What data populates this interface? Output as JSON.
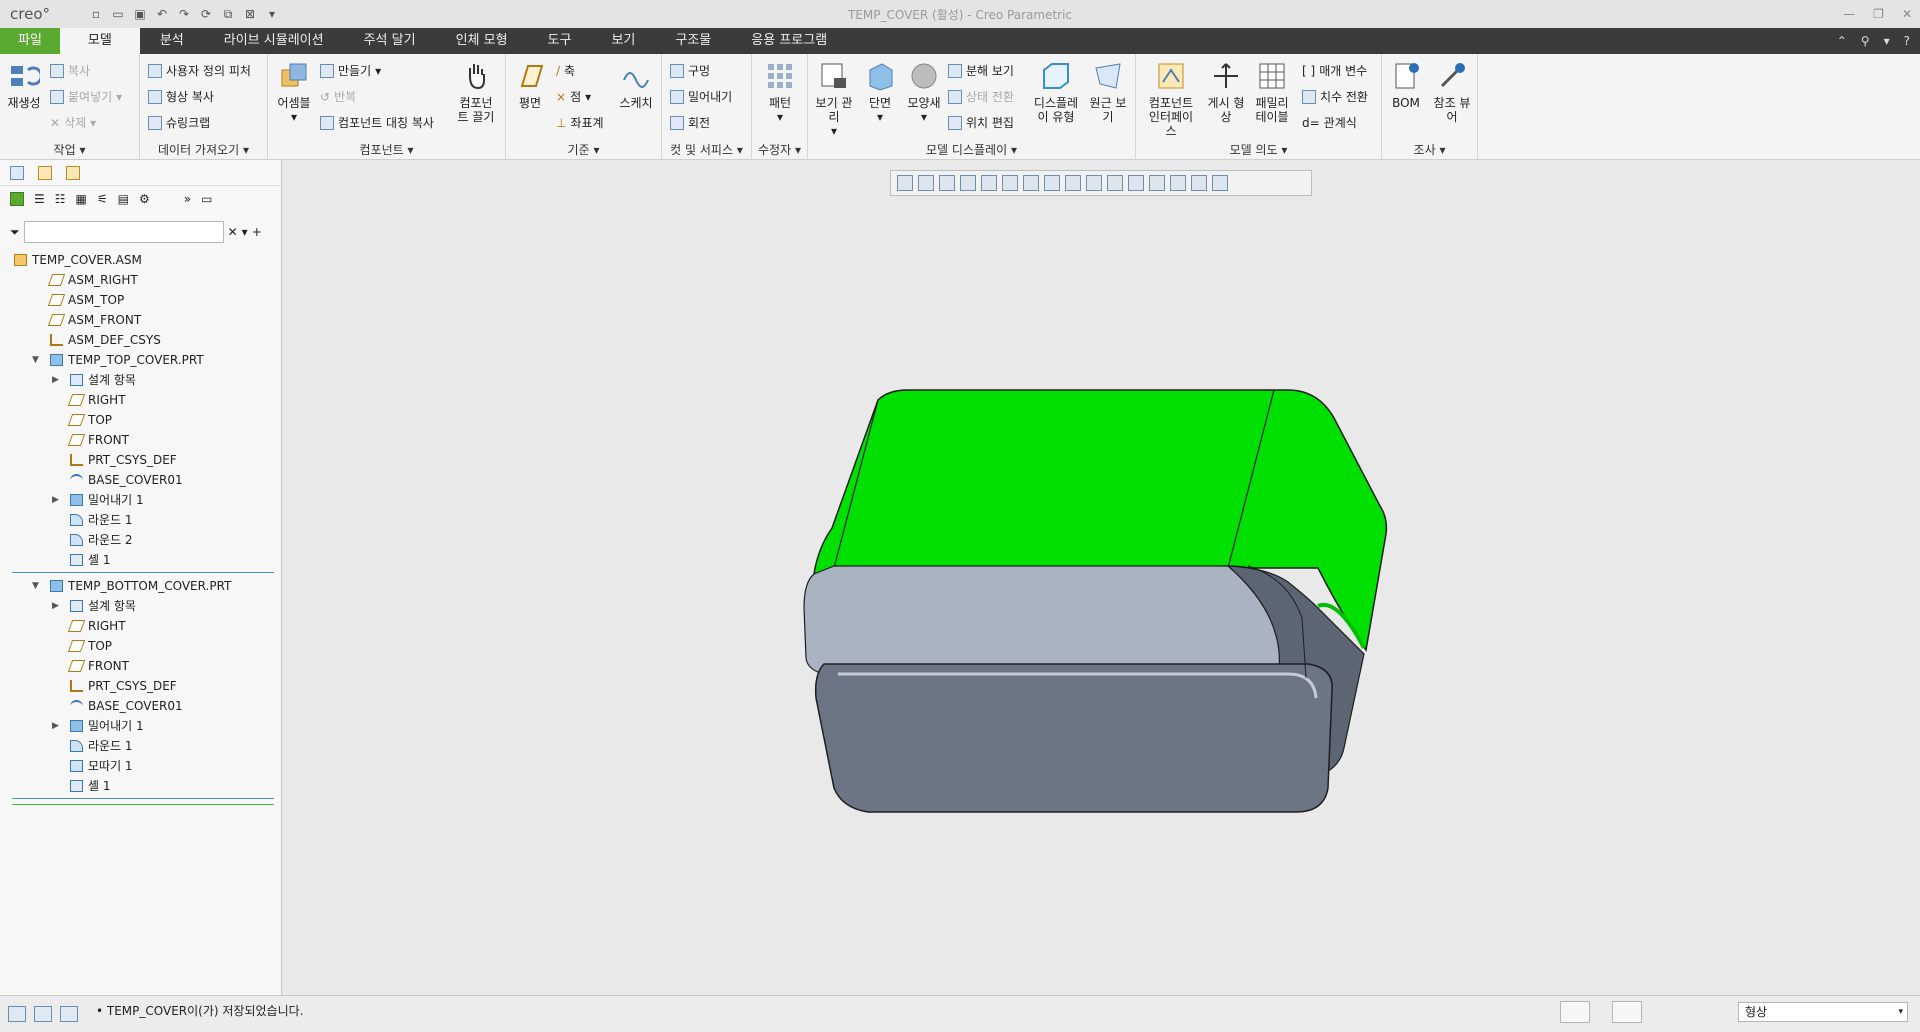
{
  "app": {
    "logo": "creo°",
    "title": "TEMP_COVER (활성) - Creo Parametric"
  },
  "menu": {
    "tabs": [
      "파일",
      "모델",
      "분석",
      "라이브 시뮬레이션",
      "주석 달기",
      "인체 모형",
      "도구",
      "보기",
      "구조물",
      "응용 프로그램"
    ],
    "active": "모델"
  },
  "ribbon": {
    "operations": {
      "regen": "재생성",
      "copy": "복사",
      "paste": "붙여넣기",
      "delete": "삭제",
      "label": "작업"
    },
    "get_data": {
      "udf": "사용자 정의 피처",
      "copy_geom": "형상 복사",
      "shrinkwrap": "슈링크랩",
      "label": "데이터 가져오기"
    },
    "component": {
      "assemble": "어셈블",
      "create": "만들기",
      "repeat": "반복",
      "mirror": "컴포넌트 대칭 복사",
      "drag": "컴포넌트 끌기",
      "label": "컴포넌트"
    },
    "datum": {
      "plane": "평면",
      "axis": "축",
      "point": "점",
      "csys": "좌표계",
      "sketch": "스케치",
      "label": "기준"
    },
    "cut_surface": {
      "hole": "구멍",
      "extrude": "밀어내기",
      "revolve": "회전",
      "label": "컷 및 서피스"
    },
    "modifiers": {
      "pattern": "패턴",
      "label": "수정자"
    },
    "model_display": {
      "view_manager": "보기 관리",
      "section": "단면",
      "appearance": "모양새",
      "exploded": "분해 보기",
      "toggle_status": "상태 전환",
      "edit_position": "위치 편집",
      "display_style": "디스플레이 유형",
      "perspective": "원근 보기",
      "label": "모델 디스플레이"
    },
    "model_intent": {
      "comp_interface": "컴포넌트 인터페이스",
      "publish_geom": "게시 형상",
      "family_table": "패밀리 테이블",
      "parameters": "매개 변수",
      "switch_dims": "치수 전환",
      "relations": "관계식",
      "label": "모델 의도"
    },
    "investigate": {
      "bom": "BOM",
      "ref_viewer": "참조 뷰어",
      "label": "조사"
    }
  },
  "tree": {
    "search_placeholder": "",
    "items": [
      {
        "label": "TEMP_COVER.ASM",
        "level": 0,
        "icon": "assembly-icon"
      },
      {
        "label": "ASM_RIGHT",
        "level": 1,
        "icon": "datum-plane-icon"
      },
      {
        "label": "ASM_TOP",
        "level": 1,
        "icon": "datum-plane-icon"
      },
      {
        "label": "ASM_FRONT",
        "level": 1,
        "icon": "datum-plane-icon"
      },
      {
        "label": "ASM_DEF_CSYS",
        "level": 1,
        "icon": "csys-icon"
      },
      {
        "label": "TEMP_TOP_COVER.PRT",
        "level": 1,
        "icon": "part-icon",
        "expanded": true
      },
      {
        "label": "설계 항목",
        "level": 2,
        "icon": "design-items-icon",
        "collapsed": true
      },
      {
        "label": "RIGHT",
        "level": 2,
        "icon": "datum-plane-icon"
      },
      {
        "label": "TOP",
        "level": 2,
        "icon": "datum-plane-icon"
      },
      {
        "label": "FRONT",
        "level": 2,
        "icon": "datum-plane-icon"
      },
      {
        "label": "PRT_CSYS_DEF",
        "level": 2,
        "icon": "csys-icon"
      },
      {
        "label": "BASE_COVER01",
        "level": 2,
        "icon": "sketch-icon"
      },
      {
        "label": "밀어내기 1",
        "level": 2,
        "icon": "extrude-icon",
        "collapsed": true
      },
      {
        "label": "라운드 1",
        "level": 2,
        "icon": "round-icon"
      },
      {
        "label": "라운드 2",
        "level": 2,
        "icon": "round-icon"
      },
      {
        "label": "셸 1",
        "level": 2,
        "icon": "shell-icon"
      },
      {
        "sep": "blue"
      },
      {
        "label": "TEMP_BOTTOM_COVER.PRT",
        "level": 1,
        "icon": "part-icon",
        "expanded": true
      },
      {
        "label": "설계 항목",
        "level": 2,
        "icon": "design-items-icon",
        "collapsed": true
      },
      {
        "label": "RIGHT",
        "level": 2,
        "icon": "datum-plane-icon"
      },
      {
        "label": "TOP",
        "level": 2,
        "icon": "datum-plane-icon"
      },
      {
        "label": "FRONT",
        "level": 2,
        "icon": "datum-plane-icon"
      },
      {
        "label": "PRT_CSYS_DEF",
        "level": 2,
        "icon": "csys-icon"
      },
      {
        "label": "BASE_COVER01",
        "level": 2,
        "icon": "sketch-icon"
      },
      {
        "label": "밀어내기 1",
        "level": 2,
        "icon": "extrude-icon",
        "collapsed": true
      },
      {
        "label": "라운드 1",
        "level": 2,
        "icon": "round-icon"
      },
      {
        "label": "모따기 1",
        "level": 2,
        "icon": "chamfer-icon"
      },
      {
        "label": "셸 1",
        "level": 2,
        "icon": "shell-icon"
      },
      {
        "sep": "blue"
      },
      {
        "sep": "green"
      }
    ]
  },
  "status": {
    "message": "• TEMP_COVER이(가) 저장되었습니다.",
    "filter": "형상"
  },
  "colors": {
    "top_cover": "#00e000",
    "bottom_cover": "#6b7583",
    "viewport_bg": "#e9e9e9"
  }
}
